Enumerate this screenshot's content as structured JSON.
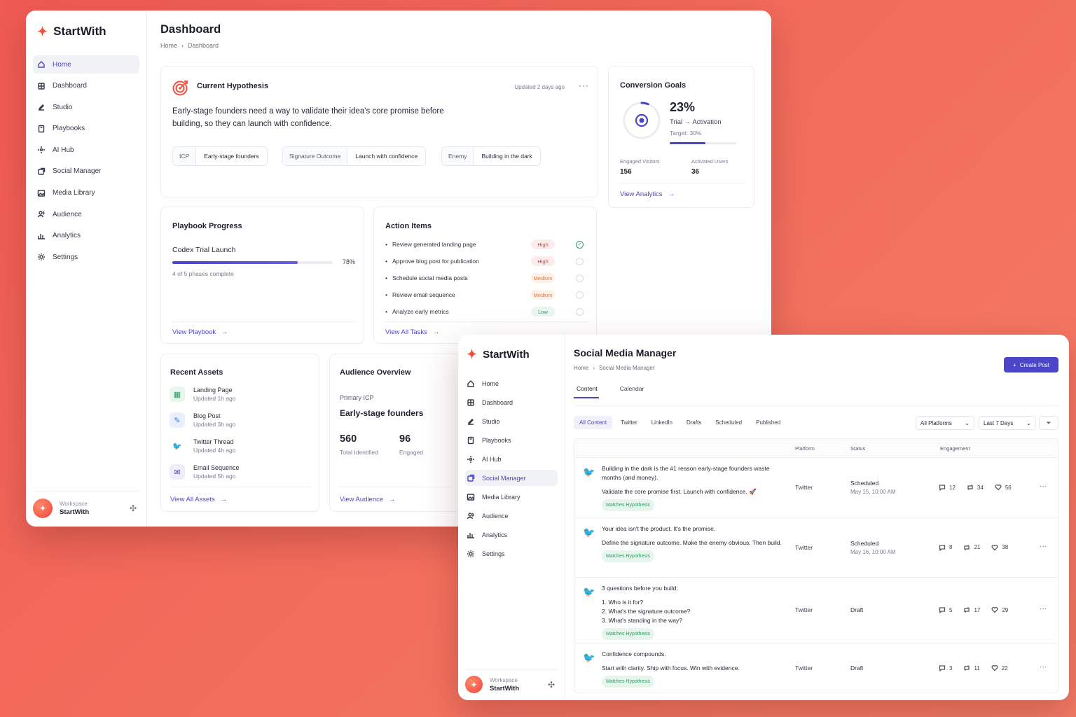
{
  "colors": {
    "accent": "#4a46c7",
    "brand": "#f0503e",
    "twitter": "#1d9bf0",
    "success": "#2f9b62",
    "high": "#d9403b",
    "medium": "#e27a3c"
  },
  "brand": {
    "name": "StartWith"
  },
  "nav": [
    {
      "label": "Home",
      "icon": "home-icon"
    },
    {
      "label": "Dashboard",
      "icon": "grid-icon"
    },
    {
      "label": "Studio",
      "icon": "edit-icon"
    },
    {
      "label": "Playbooks",
      "icon": "book-icon"
    },
    {
      "label": "AI Hub",
      "icon": "ai-icon"
    },
    {
      "label": "Social Manager",
      "icon": "share-icon"
    },
    {
      "label": "Media Library",
      "icon": "image-icon"
    },
    {
      "label": "Audience",
      "icon": "users-icon"
    },
    {
      "label": "Analytics",
      "icon": "chart-icon"
    },
    {
      "label": "Settings",
      "icon": "gear-icon"
    }
  ],
  "workspace": {
    "label": "Workspace",
    "name": "StartWith"
  },
  "dashboard": {
    "title": "Dashboard",
    "breadcrumb": [
      "Home",
      "Dashboard"
    ],
    "hypothesis": {
      "title": "Current Hypothesis",
      "updated": "Updated 2 days ago",
      "text": "Early-stage founders need a way to validate their idea's core promise before building, so they can launch with confidence.",
      "chips": [
        {
          "key": "ICP",
          "value": "Early-stage founders"
        },
        {
          "key": "Signature Outcome",
          "value": "Launch with confidence"
        },
        {
          "key": "Enemy",
          "value": "Building in the dark"
        }
      ]
    },
    "conversion": {
      "title": "Conversion Goals",
      "value": "23%",
      "progress": 0.23,
      "label": "Trial → Activation",
      "target": "Target: 30%",
      "stats": [
        {
          "label": "Engaged Visitors",
          "value": "156"
        },
        {
          "label": "Activated Users",
          "value": "36"
        }
      ],
      "link": "View Analytics"
    },
    "playbook": {
      "title": "Playbook Progress",
      "name": "Codex Trial Launch",
      "progress": 0.78,
      "percent": "78%",
      "sub": "4 of 5 phases complete",
      "link": "View Playbook"
    },
    "actions": {
      "title": "Action Items",
      "items": [
        {
          "text": "Review generated landing page",
          "priority": "High",
          "level": "high",
          "done": true
        },
        {
          "text": "Approve blog post for publication",
          "priority": "High",
          "level": "high",
          "done": false
        },
        {
          "text": "Schedule social media posts",
          "priority": "Medium",
          "level": "med",
          "done": false
        },
        {
          "text": "Review email sequence",
          "priority": "Medium",
          "level": "med",
          "done": false
        },
        {
          "text": "Analyze early metrics",
          "priority": "Low",
          "level": "low",
          "done": false
        }
      ],
      "link": "View All Tasks"
    },
    "assets": {
      "title": "Recent Assets",
      "items": [
        {
          "name": "Landing Page",
          "when": "Updated 1h ago",
          "icon": "landing-page-icon"
        },
        {
          "name": "Blog Post",
          "when": "Updated 3h ago",
          "icon": "blog-icon"
        },
        {
          "name": "Twitter Thread",
          "when": "Updated 4h ago",
          "icon": "twitter-icon"
        },
        {
          "name": "Email Sequence",
          "when": "Updated 5h ago",
          "icon": "email-icon"
        }
      ],
      "link": "View All Assets"
    },
    "audience": {
      "title": "Audience Overview",
      "label": "Primary ICP",
      "icp": "Early-stage founders",
      "stats": [
        {
          "value": "560",
          "label": "Total Identified"
        },
        {
          "value": "96",
          "label": "Engaged"
        }
      ],
      "link": "View Audience"
    }
  },
  "social": {
    "title": "Social Media Manager",
    "breadcrumb": [
      "Home",
      "Social Media Manager"
    ],
    "create": "Create Post",
    "tabs": [
      "Content",
      "Calendar"
    ],
    "filters": [
      "All Content",
      "Twitter",
      "LinkedIn",
      "Drafts",
      "Scheduled",
      "Published"
    ],
    "platform_select": "All Platforms",
    "range_select": "Last 7 Days",
    "columns": [
      "Platform",
      "Status",
      "Engagement"
    ],
    "posts": [
      {
        "lines": [
          "Building in the dark is the #1 reason early-stage founders waste months (and money).",
          "Validate the core promise first. Launch with confidence. 🚀"
        ],
        "tag": "Matches Hypothesis",
        "platform": "Twitter",
        "status": "Scheduled",
        "when": "May 15, 10:00 AM",
        "comments": "12",
        "reposts": "34",
        "likes": "56"
      },
      {
        "lines": [
          "Your idea isn't the product. It's the promise.",
          "Define the signature outcome. Make the enemy obvious. Then build."
        ],
        "tag": "Matches Hypothesis",
        "platform": "Twitter",
        "status": "Scheduled",
        "when": "May 16, 10:00 AM",
        "comments": "8",
        "reposts": "21",
        "likes": "38"
      },
      {
        "lines": [
          "3 questions before you build:",
          "1. Who is it for?",
          "2. What's the signature outcome?",
          "3. What's standing in the way?"
        ],
        "tag": "Matches Hypothesis",
        "platform": "Twitter",
        "status": "Draft",
        "when": "",
        "comments": "5",
        "reposts": "17",
        "likes": "29"
      },
      {
        "lines": [
          "Confidence compounds.",
          "Start with clarity. Ship with focus. Win with evidence."
        ],
        "tag": "Matches Hypothesis",
        "platform": "Twitter",
        "status": "Draft",
        "when": "",
        "comments": "3",
        "reposts": "11",
        "likes": "22"
      }
    ]
  }
}
